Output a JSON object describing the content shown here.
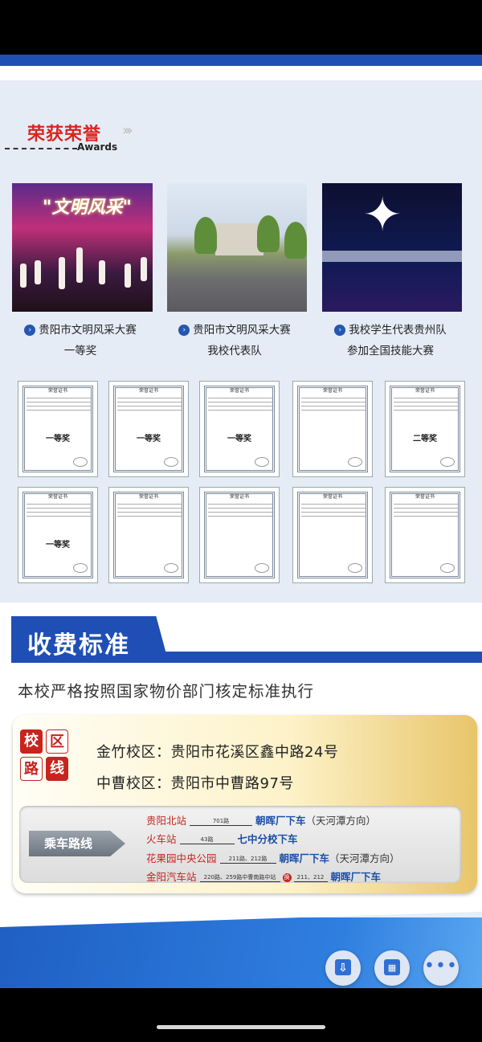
{
  "awards": {
    "title": "荣获荣誉",
    "arrows": "›››",
    "subtitle_en": "Awards"
  },
  "photos": [
    {
      "image_title": "\"文明风采\"",
      "caption_line1": "贵阳市文明风采大赛",
      "caption_line2": "一等奖"
    },
    {
      "caption_line1": "贵阳市文明风采大赛",
      "caption_line2": "我校代表队"
    },
    {
      "caption_line1": "我校学生代表贵州队",
      "caption_line2": "参加全国技能大赛"
    }
  ],
  "certificates": {
    "row1": [
      {
        "title": "荣誉证书",
        "prize": "一等奖"
      },
      {
        "title": "荣誉证书",
        "prize": "一等奖"
      },
      {
        "title": "荣誉证书",
        "prize": "一等奖"
      },
      {
        "title": "荣誉证书",
        "prize": ""
      },
      {
        "title": "荣誉证书",
        "prize": "二等奖"
      }
    ],
    "row2": [
      {
        "title": "荣誉证书",
        "prize": "一等奖"
      },
      {
        "title": "荣誉证书",
        "prize": ""
      },
      {
        "title": "荣誉证书",
        "prize": ""
      },
      {
        "title": "荣誉证书",
        "prize": ""
      },
      {
        "title": "荣誉证书",
        "prize": ""
      }
    ]
  },
  "fees": {
    "title": "收费标准",
    "description": "本校严格按照国家物价部门核定标准执行"
  },
  "campus": {
    "grid": [
      "校",
      "区",
      "路",
      "线"
    ],
    "addresses": [
      {
        "label": "金竹校区：",
        "value": "贵阳市花溪区鑫中路24号"
      },
      {
        "label": "中曹校区：",
        "value": "贵阳市中曹路97号"
      }
    ]
  },
  "bus": {
    "label": "乘车路线",
    "routes": [
      {
        "station": "贵阳北站",
        "line": "701路",
        "dest": "朝晖厂下车",
        "note": "（天河潭方向）"
      },
      {
        "station": "火车站",
        "line": "43路",
        "dest": "七中分校下车",
        "note": ""
      },
      {
        "station": "花果园中央公园",
        "line": "211路、212路",
        "dest": "朝晖厂下车",
        "note": "（天河潭方向）"
      },
      {
        "station": "金阳汽车站",
        "line": "220路、259路中曹南路中站",
        "marker": "换",
        "line2": "211、212",
        "dest": "朝晖厂下车",
        "note": ""
      }
    ]
  },
  "toolbar": {
    "download_icon": "download-icon",
    "grid_icon": "grid-icon",
    "more_icon": "more-icon",
    "more_glyph": "•••"
  },
  "colors": {
    "brand_blue": "#1f4fb5",
    "accent_red": "#c8241e",
    "page_bg": "#e5ecf6"
  }
}
